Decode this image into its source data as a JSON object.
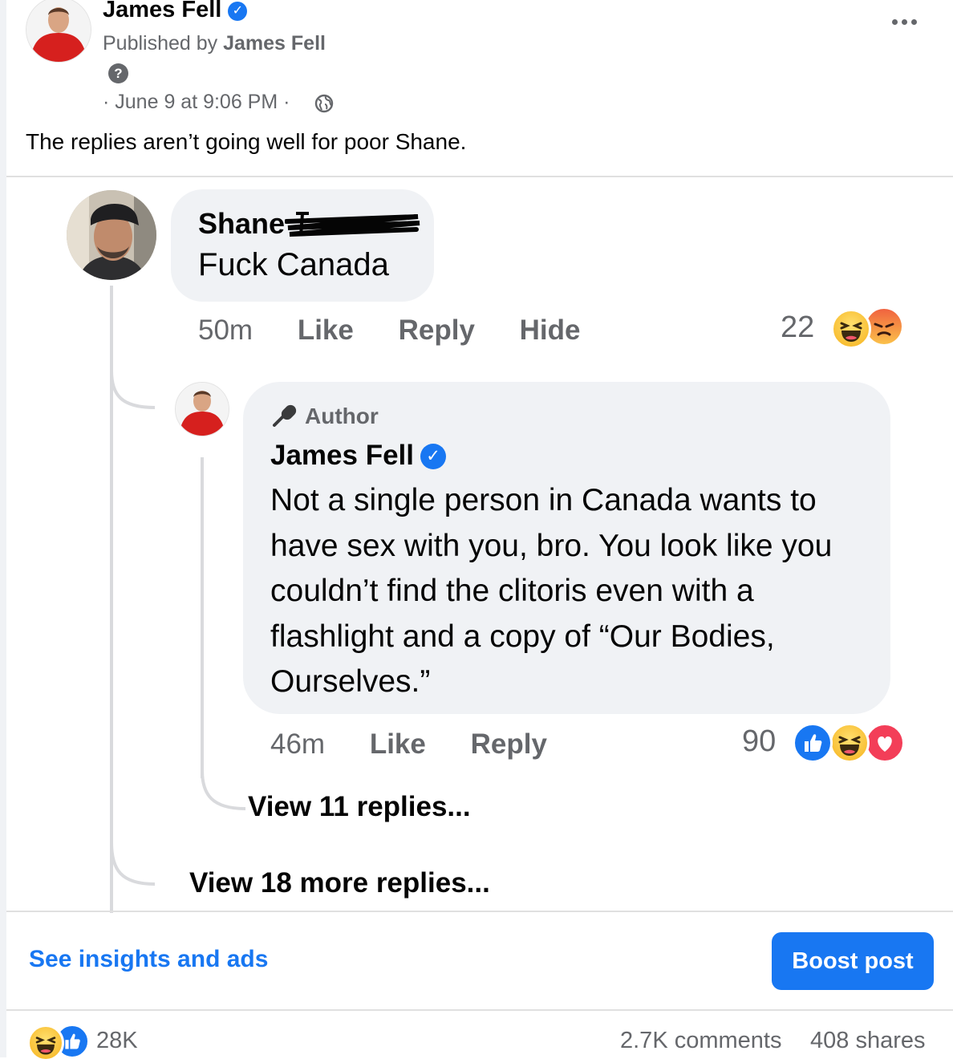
{
  "post": {
    "author_name": "James Fell",
    "published_by_prefix": "Published by ",
    "published_by_name": "James Fell",
    "date_prefix": "· ",
    "date": "June 9 at 9:06 PM",
    "date_suffix": " ·",
    "text": "The replies aren’t going well for poor Shane."
  },
  "comment": {
    "author_name": "Shane",
    "text": "Fuck Canada",
    "time": "50m",
    "like_label": "Like",
    "reply_label": "Reply",
    "hide_label": "Hide",
    "reaction_count": "22",
    "reactions": [
      "haha",
      "angry"
    ]
  },
  "reply": {
    "badge": "Author",
    "author_name": "James Fell",
    "text": "Not a single person in Canada wants to have sex with you, bro. You look like you couldn’t find the clitoris even with a flashlight and a copy of “Our Bodies, Ourselves.”",
    "time": "46m",
    "like_label": "Like",
    "reply_label": "Reply",
    "reaction_count": "90",
    "reactions": [
      "like",
      "haha",
      "love"
    ],
    "view_replies": "View 11 replies..."
  },
  "view_more_replies": "View 18 more replies...",
  "footer": {
    "insights_label": "See insights and ads",
    "boost_label": "Boost post",
    "reaction_total": "28K",
    "reactions": [
      "haha",
      "like"
    ],
    "comments": "2.7K comments",
    "shares": "408 shares"
  },
  "colors": {
    "accent": "#1877f2",
    "secondary_text": "#65676b",
    "bubble": "#f0f2f5"
  }
}
